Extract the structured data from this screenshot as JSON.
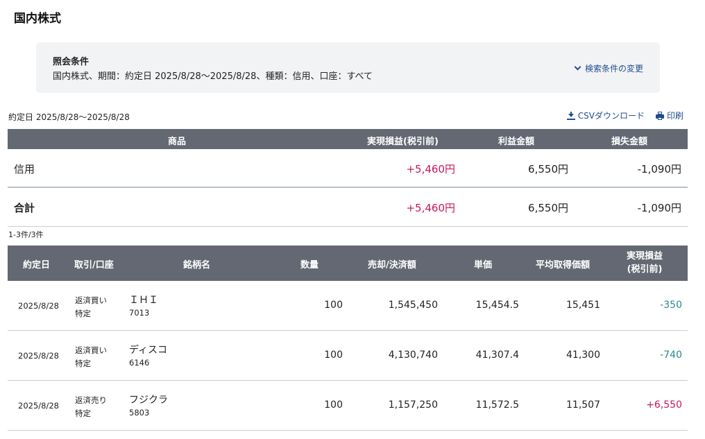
{
  "page": {
    "title": "国内株式"
  },
  "criteria": {
    "heading": "照会条件",
    "text": "国内株式、期間：約定日 2025/8/28〜2025/8/28、種類：信用、口座：すべて",
    "change_link": "検索条件の変更"
  },
  "toolbar": {
    "period": "約定日 2025/8/28〜2025/8/28",
    "csv_label": "CSVダウンロード",
    "print_label": "印刷"
  },
  "summary": {
    "headers": {
      "product": "商品",
      "realized": "実現損益(税引前)",
      "profit": "利益金額",
      "loss": "損失金額"
    },
    "rows": [
      {
        "product": "信用",
        "realized": "+5,460円",
        "profit": "6,550円",
        "loss": "-1,090円"
      }
    ],
    "total": {
      "product": "合計",
      "realized": "+5,460円",
      "profit": "6,550円",
      "loss": "-1,090円"
    }
  },
  "count": "1-3件/3件",
  "detail": {
    "headers": {
      "date": "約定日",
      "trade": "取引/口座",
      "name": "銘柄名",
      "qty": "数量",
      "amount": "売却/決済額",
      "price": "単価",
      "avg": "平均取得価額",
      "realized_1": "実現損益",
      "realized_2": "(税引前)"
    },
    "rows": [
      {
        "date": "2025/8/28",
        "trade": "返済買い",
        "account": "特定",
        "name": "ＩＨＩ",
        "code": "7013",
        "qty": "100",
        "amount": "1,545,450",
        "price": "15,454.5",
        "avg": "15,451",
        "realized": "-350",
        "sign": "neg"
      },
      {
        "date": "2025/8/28",
        "trade": "返済買い",
        "account": "特定",
        "name": "ディスコ",
        "code": "6146",
        "qty": "100",
        "amount": "4,130,740",
        "price": "41,307.4",
        "avg": "41,300",
        "realized": "-740",
        "sign": "neg"
      },
      {
        "date": "2025/8/28",
        "trade": "返済売り",
        "account": "特定",
        "name": "フジクラ",
        "code": "5803",
        "qty": "100",
        "amount": "1,157,250",
        "price": "11,572.5",
        "avg": "11,507",
        "realized": "+6,550",
        "sign": "pos"
      }
    ]
  },
  "colors": {
    "header_bg": "#636872",
    "positive": "#c8165c",
    "negative": "#2a8a8a",
    "link": "#1f4e8c"
  }
}
